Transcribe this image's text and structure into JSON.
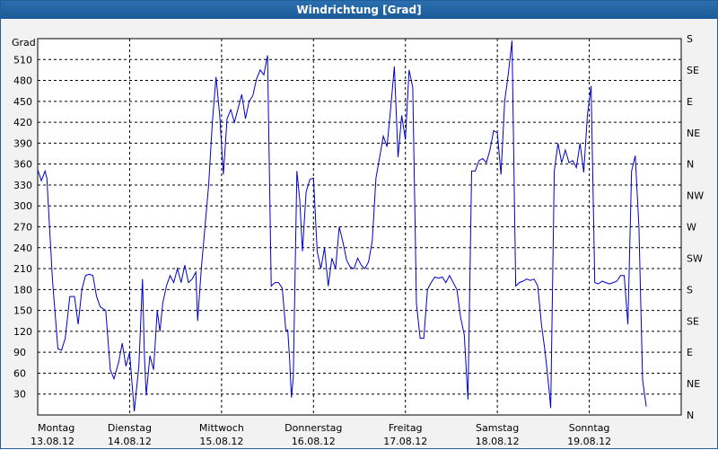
{
  "window": {
    "title": "Windrichtung [Grad]"
  },
  "colors": {
    "series": "#0000cc",
    "titlebar": "#1b5a97",
    "plot_bg": "#ffffff",
    "grid": "#000000"
  },
  "chart_data": {
    "type": "line",
    "title": "Windrichtung [Grad]",
    "ylabel": "Grad",
    "xlabel": "",
    "ylim": [
      0,
      540
    ],
    "y_ticks": [
      30,
      60,
      90,
      120,
      150,
      180,
      210,
      240,
      270,
      300,
      330,
      360,
      390,
      420,
      450,
      480,
      510
    ],
    "y2_ticks": [
      "N",
      "NE",
      "E",
      "SE",
      "S",
      "SW",
      "W",
      "NW",
      "N",
      "NE",
      "E",
      "SE",
      "S"
    ],
    "days": [
      {
        "day": "Montag",
        "date": "13.08.12"
      },
      {
        "day": "Dienstag",
        "date": "14.08.12"
      },
      {
        "day": "Mittwoch",
        "date": "15.08.12"
      },
      {
        "day": "Donnerstag",
        "date": "16.08.12"
      },
      {
        "day": "Freitag",
        "date": "17.08.12"
      },
      {
        "day": "Samstag",
        "date": "18.08.12"
      },
      {
        "day": "Sonntag",
        "date": "19.08.12"
      }
    ],
    "xlim_days": [
      0,
      7
    ],
    "grid": true,
    "series": [
      {
        "points": [
          [
            0.0,
            352
          ],
          [
            0.04,
            336
          ],
          [
            0.08,
            350
          ],
          [
            0.1,
            340
          ],
          [
            0.16,
            195
          ],
          [
            0.22,
            95
          ],
          [
            0.26,
            93
          ],
          [
            0.3,
            110
          ],
          [
            0.35,
            170
          ],
          [
            0.4,
            170
          ],
          [
            0.44,
            130
          ],
          [
            0.48,
            180
          ],
          [
            0.52,
            200
          ],
          [
            0.56,
            202
          ],
          [
            0.6,
            200
          ],
          [
            0.64,
            170
          ],
          [
            0.68,
            155
          ],
          [
            0.74,
            150
          ],
          [
            0.79,
            65
          ],
          [
            0.83,
            52
          ],
          [
            0.88,
            75
          ],
          [
            0.92,
            103
          ],
          [
            0.96,
            70
          ],
          [
            1.0,
            90
          ],
          [
            1.02,
            55
          ],
          [
            1.05,
            5
          ],
          [
            1.1,
            70
          ],
          [
            1.14,
            195
          ],
          [
            1.16,
            90
          ],
          [
            1.18,
            28
          ],
          [
            1.22,
            85
          ],
          [
            1.26,
            65
          ],
          [
            1.3,
            150
          ],
          [
            1.33,
            120
          ],
          [
            1.36,
            160
          ],
          [
            1.4,
            185
          ],
          [
            1.44,
            200
          ],
          [
            1.48,
            190
          ],
          [
            1.52,
            210
          ],
          [
            1.56,
            190
          ],
          [
            1.6,
            215
          ],
          [
            1.64,
            190
          ],
          [
            1.68,
            195
          ],
          [
            1.72,
            205
          ],
          [
            1.74,
            135
          ],
          [
            1.78,
            210
          ],
          [
            1.82,
            270
          ],
          [
            1.86,
            330
          ],
          [
            1.9,
            420
          ],
          [
            1.94,
            485
          ],
          [
            1.98,
            430
          ],
          [
            2.02,
            345
          ],
          [
            2.06,
            425
          ],
          [
            2.1,
            438
          ],
          [
            2.14,
            420
          ],
          [
            2.18,
            440
          ],
          [
            2.22,
            460
          ],
          [
            2.26,
            425
          ],
          [
            2.3,
            450
          ],
          [
            2.34,
            458
          ],
          [
            2.38,
            482
          ],
          [
            2.42,
            495
          ],
          [
            2.46,
            488
          ],
          [
            2.5,
            516
          ],
          [
            2.54,
            185
          ],
          [
            2.58,
            190
          ],
          [
            2.62,
            190
          ],
          [
            2.66,
            182
          ],
          [
            2.7,
            120
          ],
          [
            2.72,
            122
          ],
          [
            2.74,
            80
          ],
          [
            2.76,
            25
          ],
          [
            2.78,
            55
          ],
          [
            2.82,
            350
          ],
          [
            2.85,
            310
          ],
          [
            2.88,
            235
          ],
          [
            2.92,
            320
          ],
          [
            2.96,
            338
          ],
          [
            3.0,
            340
          ],
          [
            3.04,
            235
          ],
          [
            3.08,
            210
          ],
          [
            3.12,
            240
          ],
          [
            3.16,
            185
          ],
          [
            3.2,
            225
          ],
          [
            3.24,
            210
          ],
          [
            3.28,
            270
          ],
          [
            3.32,
            248
          ],
          [
            3.36,
            222
          ],
          [
            3.4,
            212
          ],
          [
            3.44,
            210
          ],
          [
            3.48,
            225
          ],
          [
            3.52,
            215
          ],
          [
            3.56,
            210
          ],
          [
            3.6,
            220
          ],
          [
            3.64,
            250
          ],
          [
            3.68,
            340
          ],
          [
            3.72,
            370
          ],
          [
            3.76,
            400
          ],
          [
            3.8,
            385
          ],
          [
            3.84,
            440
          ],
          [
            3.88,
            500
          ],
          [
            3.92,
            370
          ],
          [
            3.96,
            430
          ],
          [
            4.0,
            395
          ],
          [
            4.04,
            495
          ],
          [
            4.08,
            470
          ],
          [
            4.12,
            160
          ],
          [
            4.16,
            110
          ],
          [
            4.2,
            110
          ],
          [
            4.24,
            180
          ],
          [
            4.28,
            190
          ],
          [
            4.32,
            198
          ],
          [
            4.36,
            196
          ],
          [
            4.4,
            198
          ],
          [
            4.44,
            190
          ],
          [
            4.48,
            200
          ],
          [
            4.52,
            190
          ],
          [
            4.56,
            180
          ],
          [
            4.6,
            140
          ],
          [
            4.64,
            115
          ],
          [
            4.68,
            22
          ],
          [
            4.72,
            350
          ],
          [
            4.76,
            350
          ],
          [
            4.8,
            365
          ],
          [
            4.84,
            368
          ],
          [
            4.88,
            362
          ],
          [
            4.92,
            380
          ],
          [
            4.96,
            408
          ],
          [
            5.0,
            405
          ],
          [
            5.04,
            345
          ],
          [
            5.08,
            450
          ],
          [
            5.12,
            490
          ],
          [
            5.16,
            537
          ],
          [
            5.2,
            185
          ],
          [
            5.24,
            190
          ],
          [
            5.28,
            192
          ],
          [
            5.32,
            195
          ],
          [
            5.36,
            193
          ],
          [
            5.4,
            195
          ],
          [
            5.44,
            185
          ],
          [
            5.48,
            130
          ],
          [
            5.52,
            90
          ],
          [
            5.56,
            40
          ],
          [
            5.58,
            10
          ],
          [
            5.62,
            350
          ],
          [
            5.66,
            390
          ],
          [
            5.7,
            362
          ],
          [
            5.74,
            380
          ],
          [
            5.78,
            362
          ],
          [
            5.82,
            365
          ],
          [
            5.86,
            355
          ],
          [
            5.9,
            390
          ],
          [
            5.94,
            348
          ],
          [
            5.98,
            430
          ],
          [
            6.02,
            472
          ],
          [
            6.06,
            190
          ],
          [
            6.1,
            188
          ],
          [
            6.14,
            192
          ],
          [
            6.18,
            190
          ],
          [
            6.22,
            188
          ],
          [
            6.26,
            190
          ],
          [
            6.3,
            192
          ],
          [
            6.34,
            200
          ],
          [
            6.38,
            200
          ],
          [
            6.42,
            130
          ],
          [
            6.46,
            350
          ],
          [
            6.5,
            372
          ],
          [
            6.54,
            270
          ],
          [
            6.58,
            50
          ],
          [
            6.62,
            12
          ]
        ]
      }
    ]
  }
}
